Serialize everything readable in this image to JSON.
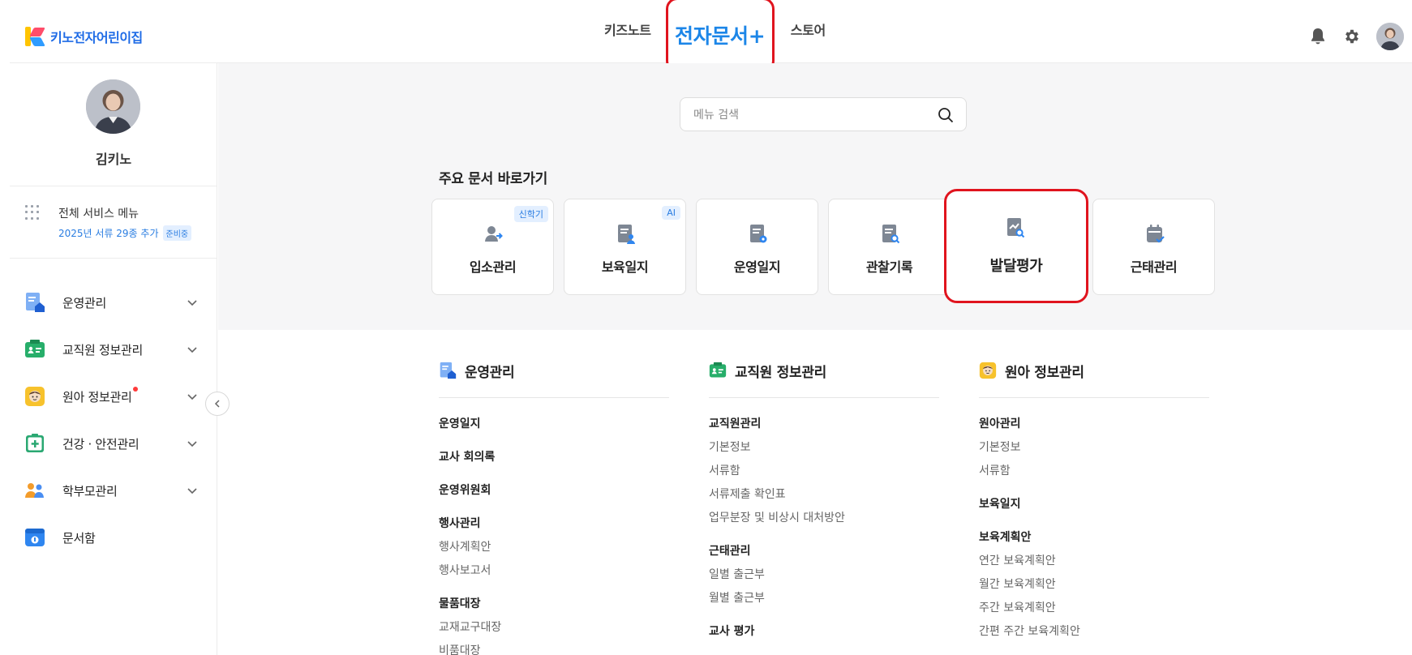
{
  "header": {
    "brand_name": "키노전자어린이집",
    "nav": {
      "kidsnote": "키즈노트",
      "edoc": "전자문서+",
      "store": "스토어"
    }
  },
  "sidebar": {
    "profile_name": "김키노",
    "all_menu": {
      "title": "전체 서비스 메뉴",
      "subtitle": "2025년 서류 29종 추가",
      "badge": "준비중"
    },
    "items": [
      {
        "label": "운영관리",
        "icon": "operation-icon"
      },
      {
        "label": "교직원 정보관리",
        "icon": "staff-icon"
      },
      {
        "label": "원아 정보관리",
        "icon": "child-icon"
      },
      {
        "label": "건강 · 안전관리",
        "icon": "health-icon"
      },
      {
        "label": "학부모관리",
        "icon": "parents-icon"
      },
      {
        "label": "문서함",
        "icon": "document-box-icon"
      }
    ]
  },
  "search": {
    "placeholder": "메뉴 검색",
    "value": ""
  },
  "shortcuts": {
    "title": "주요 문서 바로가기",
    "cards": [
      {
        "label": "입소관리",
        "badge": "신학기",
        "icon": "admission-icon"
      },
      {
        "label": "보육일지",
        "badge": "AI",
        "icon": "childcare-log-icon"
      },
      {
        "label": "운영일지",
        "icon": "operation-log-icon"
      },
      {
        "label": "관찰기록",
        "icon": "observation-icon"
      },
      {
        "label": "발달평가",
        "icon": "development-icon"
      },
      {
        "label": "근태관리",
        "icon": "attendance-icon"
      }
    ]
  },
  "sections": [
    {
      "title": "운영관리",
      "groups": [
        {
          "title": "운영일지",
          "items": []
        },
        {
          "title": "교사 회의록",
          "items": []
        },
        {
          "title": "운영위원회",
          "items": []
        },
        {
          "title": "행사관리",
          "items": [
            "행사계획안",
            "행사보고서"
          ]
        },
        {
          "title": "물품대장",
          "items": [
            "교재교구대장",
            "비품대장"
          ]
        }
      ]
    },
    {
      "title": "교직원 정보관리",
      "groups": [
        {
          "title": "교직원관리",
          "items": [
            "기본정보",
            "서류함",
            "서류제출 확인표",
            "업무분장 및 비상시 대처방안"
          ]
        },
        {
          "title": "근태관리",
          "items": [
            "일별 출근부",
            "월별 출근부"
          ]
        },
        {
          "title": "교사 평가",
          "items": []
        }
      ]
    },
    {
      "title": "원아 정보관리",
      "groups": [
        {
          "title": "원아관리",
          "items": [
            "기본정보",
            "서류함"
          ]
        },
        {
          "title": "보육일지",
          "items": []
        },
        {
          "title": "보육계획안",
          "items": [
            "연간 보육계획안",
            "월간 보육계획안",
            "주간 보육계획안",
            "간편 주간 보육계획안"
          ]
        }
      ]
    }
  ],
  "colors": {
    "brand_blue": "#1e6be6",
    "accent": "#2a7de1",
    "highlight_red": "#e0141e"
  }
}
